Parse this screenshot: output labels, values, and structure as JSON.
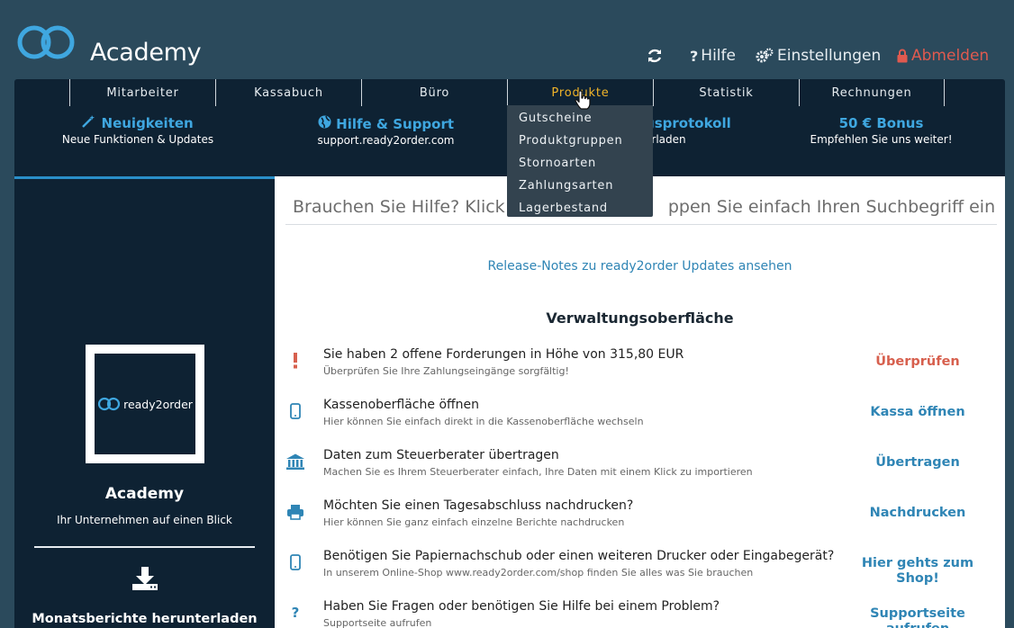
{
  "header": {
    "title": "Academy",
    "actions": [
      {
        "icon": "refresh-icon",
        "label": ""
      },
      {
        "icon": "question-icon",
        "label": "Hilfe"
      },
      {
        "icon": "gears-icon",
        "label": "Einstellungen"
      },
      {
        "icon": "lock-icon",
        "label": "Abmelden"
      }
    ]
  },
  "menu": {
    "items": [
      "Mitarbeiter",
      "Kassabuch",
      "Büro",
      "Produkte",
      "Statistik",
      "Rechnungen"
    ],
    "active": "Produkte",
    "dropdown": [
      "Gutscheine",
      "Produktgruppen",
      "Stornoarten",
      "Zahlungsarten",
      "Lagerbestand"
    ]
  },
  "promos": [
    {
      "title": "Neuigkeiten",
      "sub": "Neue Funktionen & Updates",
      "icon": "magic-wand-icon"
    },
    {
      "title": "Hilfe & Support",
      "sub": "support.ready2order.com",
      "icon": "globe-icon"
    },
    {
      "title": "gsprotokoll",
      "sub": "erladen"
    },
    {
      "title": "50 € Bonus",
      "sub": "Empfehlen Sie uns weiter!"
    }
  ],
  "sidebar": {
    "brand": "ready2order",
    "title": "Academy",
    "subtitle": "Ihr Unternehmen auf einen Blick",
    "download_label": "Monatsberichte herunterladen"
  },
  "main": {
    "search_placeholder": "Brauchen Sie Hilfe? Klick                              ppen Sie einfach Ihren Suchbegriff ein...",
    "release_link": "Release-Notes zu ready2order Updates ansehen",
    "section_title": "Verwaltungsoberfläche",
    "tasks": [
      {
        "icon": "exclamation-icon",
        "title": "Sie haben 2 offene Forderungen in Höhe von 315,80 EUR",
        "sub": "Überprüfen Sie Ihre Zahlungseingänge sorgfältig!",
        "action": "Überprüfen",
        "warn": true
      },
      {
        "icon": "tablet-icon",
        "title": "Kassenoberfläche öffnen",
        "sub": "Hier können Sie einfach direkt in die Kassenoberfläche wechseln",
        "action": "Kassa öffnen"
      },
      {
        "icon": "bank-icon",
        "title": "Daten zum Steuerberater übertragen",
        "sub": "Machen Sie es Ihrem Steuerberater einfach, Ihre Daten mit einem Klick zu importieren",
        "action": "Übertragen"
      },
      {
        "icon": "printer-icon",
        "title": "Möchten Sie einen Tagesabschluss nachdrucken?",
        "sub": "Hier können Sie ganz einfach einzelne Berichte nachdrucken",
        "action": "Nachdrucken"
      },
      {
        "icon": "tablet-icon",
        "title": "Benötigen Sie Papiernachschub oder einen weiteren Drucker oder Eingabegerät?",
        "sub": "In unserem Online-Shop www.ready2order.com/shop finden Sie alles was Sie brauchen",
        "action": "Hier gehts zum Shop!"
      },
      {
        "icon": "question-icon",
        "title": "Haben Sie Fragen oder benötigen Sie Hilfe bei einem Problem?",
        "sub": "Supportseite aufrufen",
        "action": "Supportseite aufrufen"
      }
    ]
  },
  "colors": {
    "header_bg": "#2b4a5c",
    "panel_bg": "#0e2233",
    "accent_blue": "#2f85b5",
    "active_menu": "#f0b429",
    "warn": "#d7604e"
  }
}
